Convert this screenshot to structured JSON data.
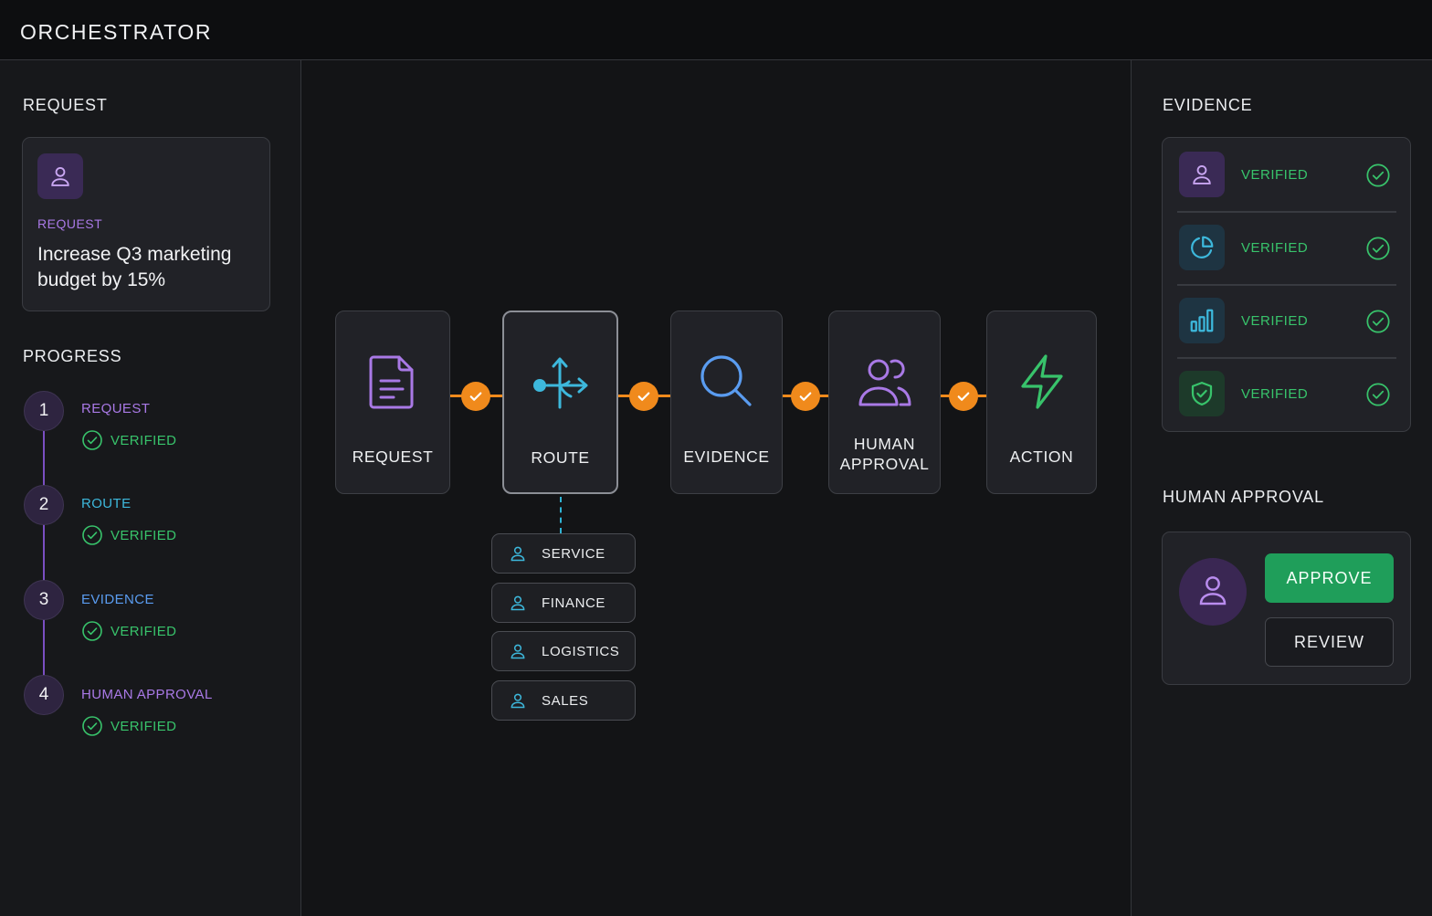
{
  "app": {
    "title": "ORCHESTRATOR"
  },
  "left": {
    "request_section_title": "REQUEST",
    "request_card": {
      "icon": "user-icon",
      "label": "REQUEST",
      "text": "Increase Q3 marketing budget by 15%"
    },
    "progress_section_title": "PROGRESS",
    "steps": [
      {
        "number": "1",
        "label": "REQUEST",
        "status": "VERIFIED",
        "color": "#a979e6"
      },
      {
        "number": "2",
        "label": "ROUTE",
        "status": "VERIFIED",
        "color": "#3db8dc"
      },
      {
        "number": "3",
        "label": "EVIDENCE",
        "status": "VERIFIED",
        "color": "#5a9cf0"
      },
      {
        "number": "4",
        "label": "HUMAN APPROVAL",
        "status": "VERIFIED",
        "color": "#a979e6"
      }
    ]
  },
  "flow": {
    "nodes": [
      {
        "label": "REQUEST",
        "icon": "document-icon",
        "color": "#a979e6"
      },
      {
        "label": "ROUTE",
        "icon": "route-split-icon",
        "color": "#3db8dc",
        "active": true
      },
      {
        "label": "EVIDENCE",
        "icon": "search-icon",
        "color": "#5a9cf0"
      },
      {
        "label": "HUMAN APPROVAL",
        "label_line1": "HUMAN",
        "label_line2": "APPROVAL",
        "icon": "users-icon",
        "color": "#a979e6"
      },
      {
        "label": "ACTION",
        "icon": "lightning-icon",
        "color": "#38c36b"
      }
    ],
    "connector_color": "#f08a1c",
    "route_options": [
      {
        "label": "SERVICE",
        "icon": "user-icon"
      },
      {
        "label": "FINANCE",
        "icon": "user-icon"
      },
      {
        "label": "LOGISTICS",
        "icon": "user-icon"
      },
      {
        "label": "SALES",
        "icon": "user-icon"
      }
    ]
  },
  "right": {
    "evidence_section_title": "EVIDENCE",
    "evidence_items": [
      {
        "icon": "user-icon",
        "status": "VERIFIED"
      },
      {
        "icon": "pie-chart-icon",
        "status": "VERIFIED"
      },
      {
        "icon": "bar-chart-icon",
        "status": "VERIFIED"
      },
      {
        "icon": "shield-check-icon",
        "status": "VERIFIED"
      }
    ],
    "approval_section_title": "HUMAN APPROVAL",
    "approval": {
      "avatar_icon": "user-icon",
      "approve_label": "APPROVE",
      "review_label": "REVIEW"
    }
  },
  "colors": {
    "verified": "#38c36b",
    "accent_purple": "#a979e6",
    "accent_cyan": "#3db8dc",
    "accent_orange": "#f08a1c",
    "approve_green": "#1f9e5a"
  }
}
